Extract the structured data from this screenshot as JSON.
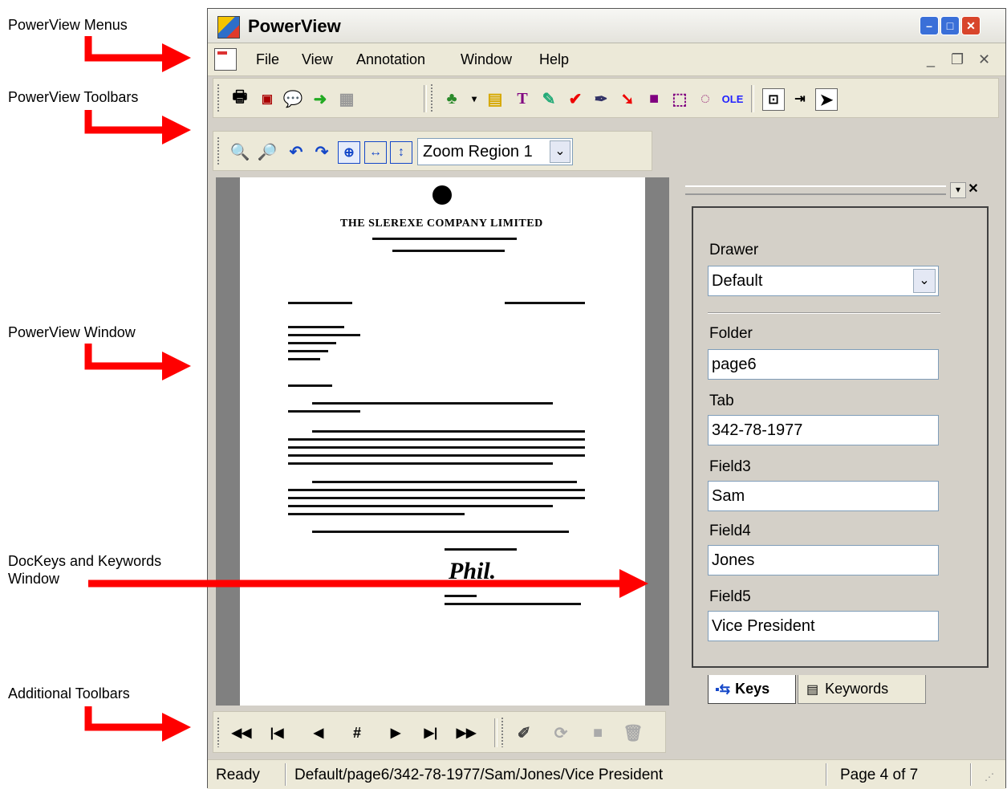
{
  "callouts": {
    "menus": "PowerView Menus",
    "toolbars": "PowerView Toolbars",
    "window": "PowerView Window",
    "dockeys": "DocKeys and Keywords\nWindow",
    "additional": "Additional Toolbars"
  },
  "window": {
    "title": "PowerView"
  },
  "menu": {
    "items": [
      "File",
      "View",
      "Annotation",
      "Window",
      "Help"
    ]
  },
  "zoom": {
    "selected": "Zoom Region 1"
  },
  "document": {
    "company": "THE SLEREXE COMPANY LIMITED",
    "signature": "Phil."
  },
  "panel": {
    "drawer_label": "Drawer",
    "drawer_value": "Default",
    "fields": [
      {
        "label": "Folder",
        "value": "page6"
      },
      {
        "label": "Tab",
        "value": "342-78-1977"
      },
      {
        "label": "Field3",
        "value": "Sam"
      },
      {
        "label": "Field4",
        "value": "Jones"
      },
      {
        "label": "Field5",
        "value": "Vice President"
      }
    ],
    "tabs": {
      "keys": "Keys",
      "keywords": "Keywords"
    }
  },
  "status": {
    "state": "Ready",
    "path": "Default/page6/342-78-1977/Sam/Jones/Vice President",
    "page": "Page 4 of 7"
  },
  "icons": {
    "nav": [
      "first-icon",
      "prev-group-icon",
      "prev-icon",
      "goto-page-icon",
      "next-icon",
      "next-group-icon",
      "last-icon"
    ],
    "accent": "#ff0000",
    "title_blue": "#0b43c4"
  }
}
